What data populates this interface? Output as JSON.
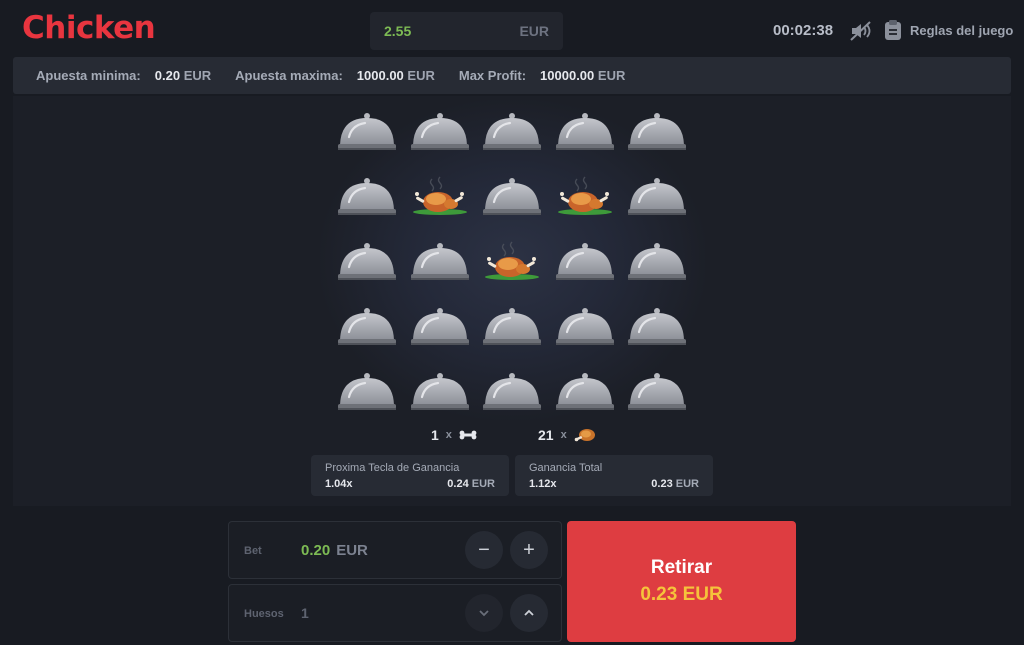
{
  "header": {
    "logo": "Chicken",
    "balance_amount": "2.55",
    "balance_currency": "EUR",
    "timer": "00:02:38",
    "sound_icon": "sound-muted-icon",
    "rules_label": "Reglas del juego"
  },
  "infobar": {
    "min_label": "Apuesta minima:",
    "min_value": "0.20",
    "max_label": "Apuesta maxima:",
    "max_value": "1000.00",
    "profit_label": "Max Profit:",
    "profit_value": "10000.00",
    "currency": "EUR"
  },
  "board": {
    "rows": 5,
    "cols": 5,
    "cells": [
      "cloche",
      "cloche",
      "cloche",
      "cloche",
      "cloche",
      "cloche",
      "chicken",
      "cloche",
      "chicken",
      "cloche",
      "cloche",
      "cloche",
      "chicken",
      "cloche",
      "cloche",
      "cloche",
      "cloche",
      "cloche",
      "cloche",
      "cloche",
      "cloche",
      "cloche",
      "cloche",
      "cloche",
      "cloche"
    ]
  },
  "counts": {
    "bones_count": "1",
    "chickens_count": "21",
    "times": "x"
  },
  "next_win": {
    "title": "Proxima Tecla de Ganancia",
    "multiplier": "1.04x",
    "amount": "0.24",
    "currency": "EUR"
  },
  "total_win": {
    "title": "Ganancia Total",
    "multiplier": "1.12x",
    "amount": "0.23",
    "currency": "EUR"
  },
  "bet": {
    "label": "Bet",
    "value": "0.20",
    "currency": "EUR",
    "value_color": "#7dbb54",
    "minus": "−",
    "plus": "+"
  },
  "bones": {
    "label": "Huesos",
    "value": "1"
  },
  "cashout": {
    "label": "Retirar",
    "amount": "0.23 EUR",
    "bg_color": "#de3d41",
    "amount_color": "#f5c33b"
  }
}
